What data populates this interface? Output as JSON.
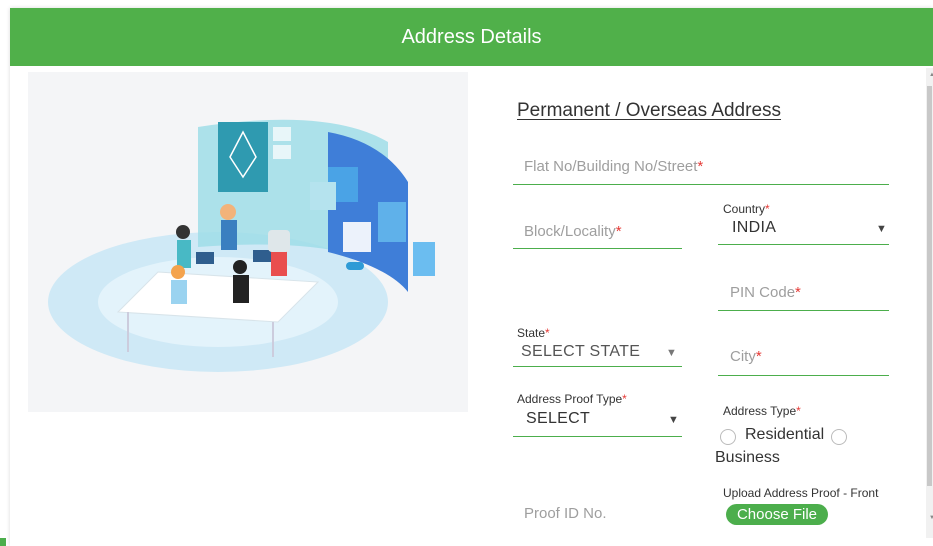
{
  "header": {
    "title": "Address Details"
  },
  "section": {
    "title": "Permanent / Overseas Address"
  },
  "fields": {
    "flat": {
      "placeholder": "Flat No/Building No/Street",
      "req": "*"
    },
    "block": {
      "placeholder": "Block/Locality",
      "req": "*"
    },
    "country": {
      "label": "Country",
      "req": "*",
      "value": "INDIA"
    },
    "pin": {
      "placeholder": "PIN Code",
      "req": "*"
    },
    "state": {
      "label": "State",
      "req": "*",
      "value": "SELECT STATE"
    },
    "city": {
      "placeholder": "City",
      "req": "*"
    },
    "proof_type": {
      "label": "Address Proof Type",
      "req": "*",
      "value": "SELECT"
    },
    "address_type": {
      "label": "Address Type",
      "req": "*",
      "options": [
        "Residential",
        "Business"
      ]
    },
    "proof_id": {
      "placeholder": "Proof ID No."
    },
    "upload": {
      "label": "Upload Address Proof - Front",
      "button": "Choose File"
    }
  },
  "colors": {
    "accent": "#4cae4c",
    "required": "#e53935"
  },
  "icons": {
    "dropdown": "caret-down-icon",
    "scroll": "scroll-arrow-icon"
  }
}
